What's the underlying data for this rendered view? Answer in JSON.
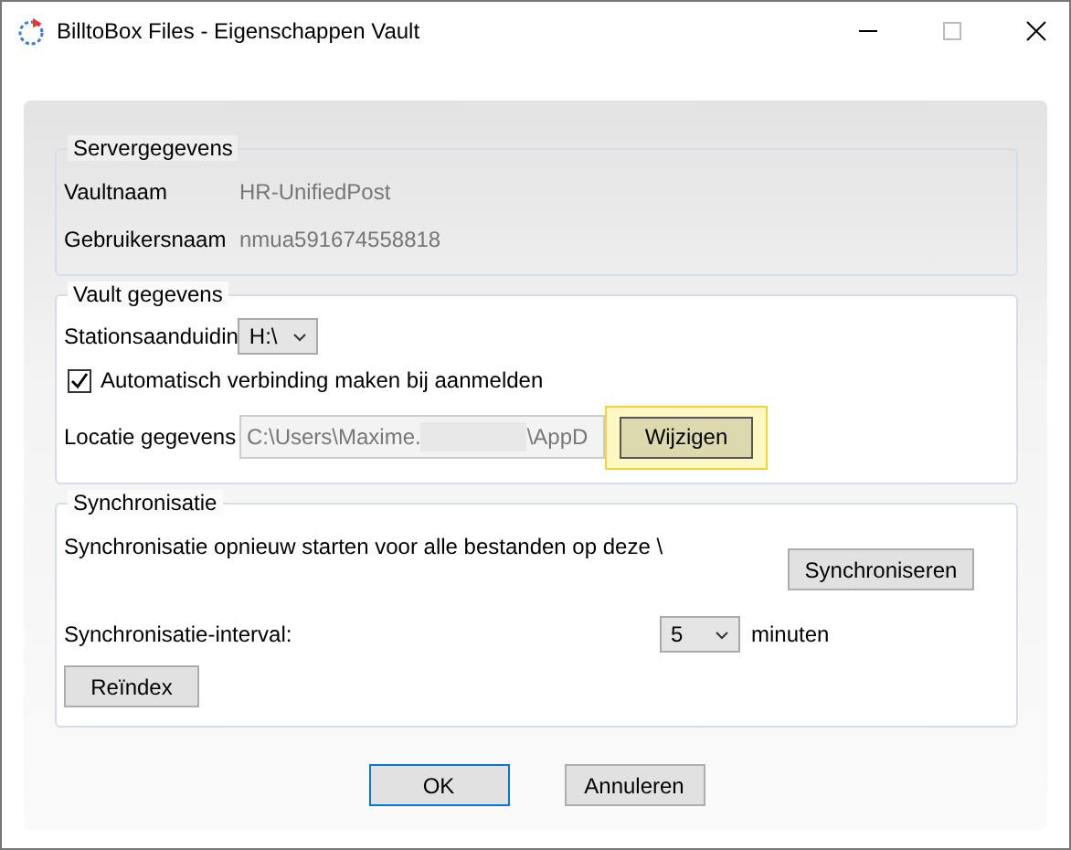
{
  "window": {
    "title": "BilltoBox Files - Eigenschappen Vault"
  },
  "server": {
    "legend": "Servergegevens",
    "rows": [
      {
        "label": "Vaultnaam",
        "value": "HR-UnifiedPost"
      },
      {
        "label": "Gebruikersnaam",
        "value": "nmua591674558818"
      }
    ]
  },
  "vault": {
    "legend": "Vault gegevens",
    "drive_label": "Stationsaanduidin",
    "drive_value": "H:\\",
    "auto_connect": {
      "label": "Automatisch verbinding maken bij aanmelden",
      "checked": true
    },
    "location_label": "Locatie gegevens",
    "location_start": "C:\\Users\\Maxime.",
    "location_end": "\\AppD",
    "change_button": {
      "label": "Wijzigen",
      "highlighted": true
    }
  },
  "sync": {
    "legend": "Synchronisatie",
    "description": "Synchronisatie opnieuw starten voor alle bestanden op deze \\",
    "sync_button": "Synchroniseren",
    "interval_label": "Synchronisatie-interval:",
    "interval_value": "5",
    "interval_unit": "minuten",
    "reindex_button": "Reïndex"
  },
  "buttons": [
    {
      "label": "OK",
      "default": true
    },
    {
      "label": "Annuleren",
      "default": false
    }
  ]
}
